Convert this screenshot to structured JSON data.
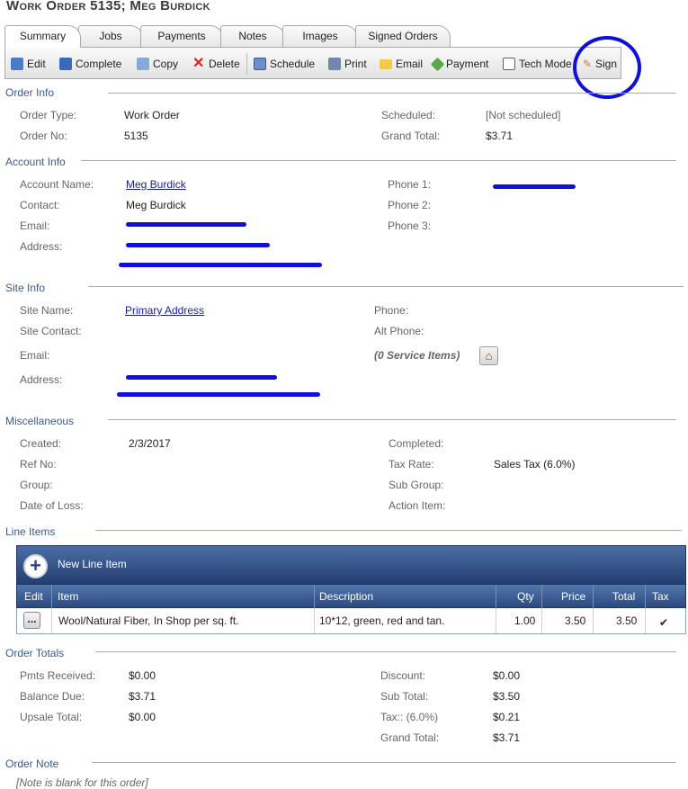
{
  "title": "Work Order 5135; Meg Burdick",
  "tabs": [
    "Summary",
    "Jobs",
    "Payments",
    "Notes",
    "Images",
    "Signed Orders"
  ],
  "toolbar": {
    "edit": "Edit",
    "complete": "Complete",
    "copy": "Copy",
    "delete": "Delete",
    "schedule": "Schedule",
    "print": "Print",
    "email": "Email",
    "payment": "Payment",
    "tech_mode": "Tech Mode",
    "sign": "Sign"
  },
  "order_info": {
    "heading": "Order Info",
    "type_label": "Order Type:",
    "type": "Work Order",
    "no_label": "Order No:",
    "no": "5135",
    "scheduled_label": "Scheduled:",
    "scheduled": "[Not scheduled]",
    "grand_total_label": "Grand Total:",
    "grand_total": "$3.71"
  },
  "account_info": {
    "heading": "Account Info",
    "name_label": "Account Name:",
    "name": "Meg Burdick",
    "contact_label": "Contact:",
    "contact": "Meg Burdick",
    "email_label": "Email:",
    "address_label": "Address:",
    "phone1_label": "Phone 1:",
    "phone2_label": "Phone 2:",
    "phone3_label": "Phone 3:"
  },
  "site_info": {
    "heading": "Site Info",
    "name_label": "Site Name:",
    "name": "Primary Address",
    "contact_label": "Site Contact:",
    "email_label": "Email:",
    "address_label": "Address:",
    "phone_label": "Phone:",
    "alt_phone_label": "Alt Phone:",
    "service_items": "(0 Service Items)"
  },
  "misc": {
    "heading": "Miscellaneous",
    "created_label": "Created:",
    "created": "2/3/2017",
    "ref_label": "Ref No:",
    "group_label": "Group:",
    "loss_label": "Date of Loss:",
    "completed_label": "Completed:",
    "tax_rate_label": "Tax Rate:",
    "tax_rate": "Sales Tax (6.0%)",
    "subgroup_label": "Sub Group:",
    "action_label": "Action Item:"
  },
  "line_items": {
    "heading": "Line Items",
    "new_label": "New Line Item",
    "columns": [
      "Edit",
      "Item",
      "Description",
      "Qty",
      "Price",
      "Total",
      "Tax"
    ],
    "rows": [
      {
        "edit": "...",
        "item": "Wool/Natural Fiber, In Shop per sq. ft.",
        "description": "10*12, green, red and tan.",
        "qty": "1.00",
        "price": "3.50",
        "total": "3.50",
        "tax": "✔"
      }
    ]
  },
  "order_totals": {
    "heading": "Order Totals",
    "pmts_label": "Pmts Received:",
    "pmts": "$0.00",
    "balance_label": "Balance Due:",
    "balance": "$3.71",
    "upsale_label": "Upsale Total:",
    "upsale": "$0.00",
    "discount_label": "Discount:",
    "discount": "$0.00",
    "subtotal_label": "Sub Total:",
    "subtotal": "$3.50",
    "tax_label": "Tax:: (6.0%)",
    "tax": "$0.21",
    "grand_label": "Grand Total:",
    "grand": "$3.71"
  },
  "order_note": {
    "heading": "Order Note",
    "text": "[Note is blank for this order]"
  }
}
